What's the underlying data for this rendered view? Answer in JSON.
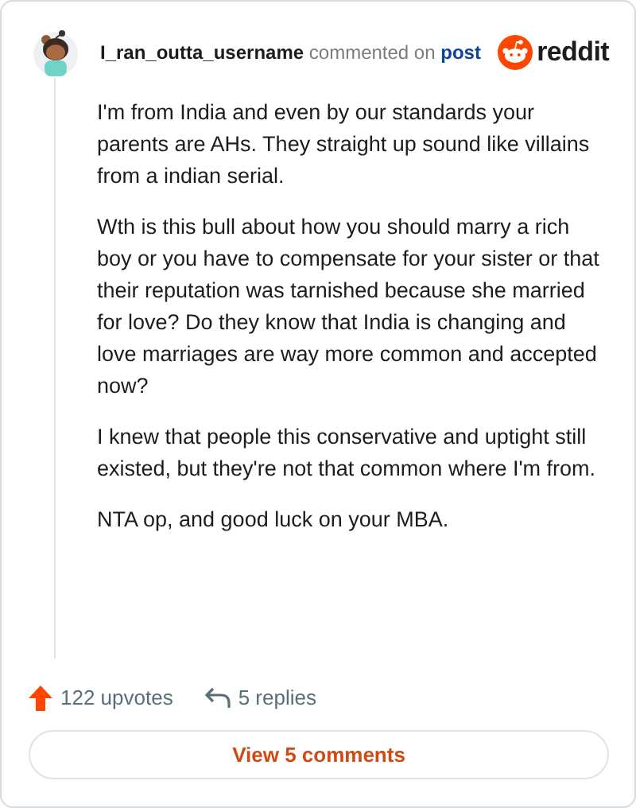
{
  "comment": {
    "author": "I_ran_outta_username",
    "action": "commented on",
    "link": "post",
    "brand": "reddit",
    "paragraphs": [
      "I'm from India and even by our standards your parents are AHs. They straight up sound like villains from a indian serial.",
      "Wth is this bull about how you should marry a rich boy or you have to compensate for your sister or that their reputation was tarnished because she married for love? Do they know that India is changing and love marriages are way more common and accepted now?",
      "I knew that people this conservative and uptight still existed, but they're not that common where I'm from.",
      "NTA op, and good luck on your MBA."
    ]
  },
  "footer": {
    "upvotes": "122 upvotes",
    "replies": "5 replies",
    "button": "View 5 comments"
  }
}
